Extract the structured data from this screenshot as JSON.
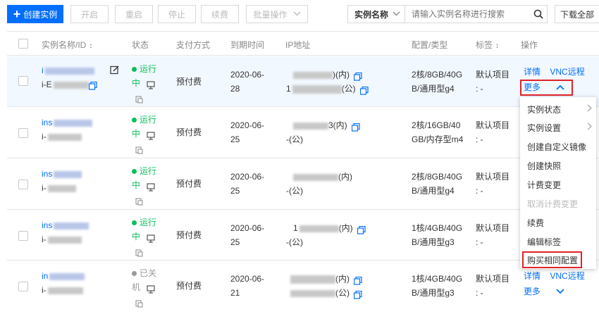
{
  "toolbar": {
    "create_label": "创建实例",
    "start_label": "开启",
    "restart_label": "重启",
    "stop_label": "停止",
    "renew_label": "续费",
    "batch_label": "批量操作",
    "search_field_label": "实例名称",
    "search_placeholder": "请输入实例名称进行搜索",
    "download_label": "下载全部"
  },
  "table": {
    "headers": {
      "name": "实例名称/ID",
      "status": "状态",
      "payment": "支付方式",
      "expiry": "到期时间",
      "ip": "IP地址",
      "config": "配置/类型",
      "tags": "标签",
      "actions": "操作"
    },
    "rows": [
      {
        "name_prefix": "i",
        "id_prefix": "i-E",
        "status_1": "运行",
        "status_2": "中",
        "payment": "预付费",
        "expiry_1": "2020-06-",
        "expiry_2": "28",
        "ip_1_suffix": ")(内)",
        "ip_2_suffix": "(公)",
        "ip_2_prefix": "1",
        "config_1": "2核/8GB/40G",
        "config_2": "B/通用型g4",
        "tag_1": "默认项目",
        "tag_2": ": -",
        "detail": "详情",
        "vnc": "VNC远程",
        "more": "更多"
      },
      {
        "name_prefix": "ins",
        "id_prefix": "i-",
        "status_1": "运行",
        "status_2": "中",
        "payment": "预付费",
        "expiry_1": "2020-06-",
        "expiry_2": "25",
        "ip_1_suffix": "3(内)",
        "ip_2_suffix": "-(公)",
        "config_1": "2核/16GB/40",
        "config_2": "GB/内存型m4",
        "tag_1": "默认项目",
        "tag_2": ": -"
      },
      {
        "name_prefix": "ins",
        "id_prefix": "i-",
        "status_1": "运行",
        "status_2": "中",
        "payment": "预付费",
        "expiry_1": "2020-06-",
        "expiry_2": "25",
        "ip_1_suffix": "(内)",
        "ip_2_suffix": "-(公)",
        "config_1": "2核/8GB/40G",
        "config_2": "B/通用型g4",
        "tag_1": "默认项目",
        "tag_2": ": -"
      },
      {
        "name_prefix": "ins",
        "id_prefix": "i-",
        "status_1": "运行",
        "status_2": "中",
        "payment": "预付费",
        "expiry_1": "2020-06-",
        "expiry_2": "25",
        "ip_1_prefix": "1",
        "ip_1_suffix": "(内)",
        "ip_2_suffix": "-(公)",
        "config_1": "1核/4GB/40G",
        "config_2": "B/通用型g3",
        "tag_1": "默认项目",
        "tag_2": ": -"
      },
      {
        "name_prefix": "in",
        "id_prefix": "i-",
        "status_1": "已关",
        "status_2": "机",
        "payment": "预付费",
        "expiry_1": "2020-06-",
        "expiry_2": "21",
        "ip_1_suffix": "(内)",
        "ip_2_suffix": "(公)",
        "config_1": "1核/4GB/40G",
        "config_2": "B/通用型g3",
        "tag_1": "默认项目",
        "tag_2": ": -",
        "detail": "详情",
        "vnc": "VNC远程",
        "more": "更多"
      }
    ]
  },
  "menu": {
    "items": [
      {
        "label": "实例状态"
      },
      {
        "label": "实例设置"
      },
      {
        "label": "创建自定义镜像"
      },
      {
        "label": "创建快照"
      },
      {
        "label": "计费变更"
      },
      {
        "label": "取消计费变更"
      },
      {
        "label": "续费"
      },
      {
        "label": "编辑标签"
      },
      {
        "label": "购买相同配置"
      }
    ]
  },
  "colors": {
    "accent": "#006eff",
    "running": "#0abf5b",
    "highlight_box": "#e0232a"
  }
}
